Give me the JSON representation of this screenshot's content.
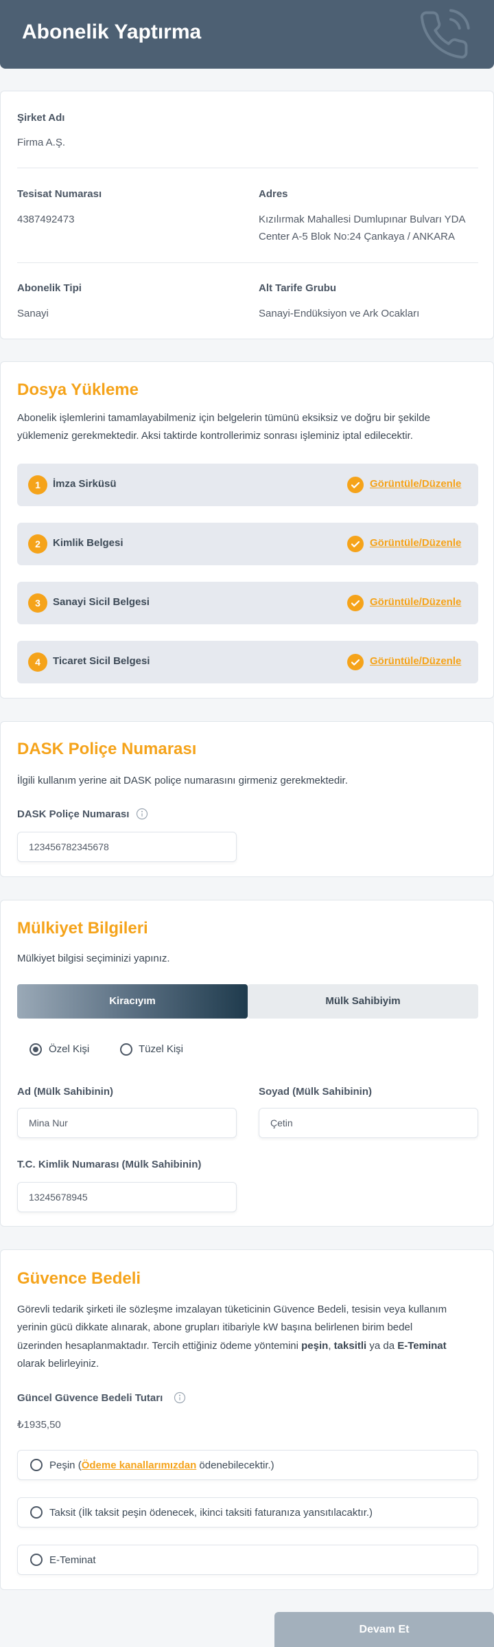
{
  "header": {
    "title": "Abonelik Yaptırma",
    "icon": "phone-icon"
  },
  "company": {
    "name_label": "Şirket Adı",
    "name_value": "Firma A.Ş.",
    "tesisat_label": "Tesisat Numarası",
    "tesisat_value": "4387492473",
    "adres_label": "Adres",
    "adres_line1": "Kızılırmak Mahallesi Dumlupınar Bulvarı YDA",
    "adres_line2": "Center A-5 Blok No:24 Çankaya / ANKARA",
    "abonelik_label": "Abonelik Tipi",
    "abonelik_value": "Sanayi",
    "tarife_label": "Alt Tarife Grubu",
    "tarife_value": "Sanayi-Endüksiyon ve Ark Ocakları"
  },
  "upload": {
    "title": "Dosya Yükleme",
    "desc_line1": "Abonelik işlemlerini tamamlayabilmeniz için belgelerin tümünü eksiksiz ve doğru bir şekilde",
    "desc_line2": "yüklemeniz gerekmektedir. Aksi taktirde kontrollerimiz sonrası işleminiz iptal edilecektir.",
    "items": [
      {
        "num": "1",
        "name": "İmza Sirküsü",
        "link": "Görüntüle/Düzenle"
      },
      {
        "num": "2",
        "name": "Kimlik Belgesi",
        "link": "Görüntüle/Düzenle"
      },
      {
        "num": "3",
        "name": "Sanayi Sicil Belgesi",
        "link": "Görüntüle/Düzenle"
      },
      {
        "num": "4",
        "name": "Ticaret Sicil Belgesi",
        "link": "Görüntüle/Düzenle"
      }
    ]
  },
  "dask": {
    "title": "DASK Poliçe Numarası",
    "desc": "İlgili kullanım yerine ait DASK poliçe numarasını girmeniz gerekmektedir.",
    "field_label": "DASK Poliçe Numarası",
    "field_value": "123456782345678"
  },
  "ownership": {
    "title": "Mülkiyet Bilgileri",
    "desc": "Mülkiyet bilgisi seçiminizi yapınız.",
    "tab_tenant": "Kiracıyım",
    "tab_owner": "Mülk Sahibiyim",
    "radio_private": "Özel Kişi",
    "radio_legal": "Tüzel Kişi",
    "name_label": "Ad (Mülk Sahibinin)",
    "name_value": "Mina Nur",
    "surname_label": "Soyad (Mülk Sahibinin)",
    "surname_value": "Çetin",
    "tc_label": "T.C. Kimlik Numarası (Mülk Sahibinin)",
    "tc_value": "13245678945"
  },
  "deposit": {
    "title": "Güvence Bedeli",
    "desc_line1": "Görevli tedarik şirketi ile sözleşme imzalayan tüketicinin Güvence Bedeli, tesisin veya kullanım",
    "desc_line2": "yerinin gücü dikkate alınarak, abone grupları itibariyle kW başına belirlenen birim bedel",
    "desc_line3_a": "üzerinden hesaplanmaktadır. Tercih ettiğiniz ödeme yöntemini ",
    "desc_line3_b": "peşin",
    "desc_line3_c": ", ",
    "desc_line3_d": "taksitli",
    "desc_line3_e": " ya da ",
    "desc_line3_f": "E-Teminat",
    "desc_line4": "olarak belirleyiniz.",
    "amount_label": "Güncel Güvence Bedeli Tutarı",
    "amount_value": "₺1935,50",
    "opt1_a": "Peşin (",
    "opt1_link": "Ödeme kanallarımızdan",
    "opt1_b": " ödenebilecektir.)",
    "opt2": "Taksit (İlk taksit peşin ödenecek, ikinci taksiti faturanıza yansıtılacaktır.)",
    "opt3": "E-Teminat"
  },
  "submit_label": "Devam Et"
}
